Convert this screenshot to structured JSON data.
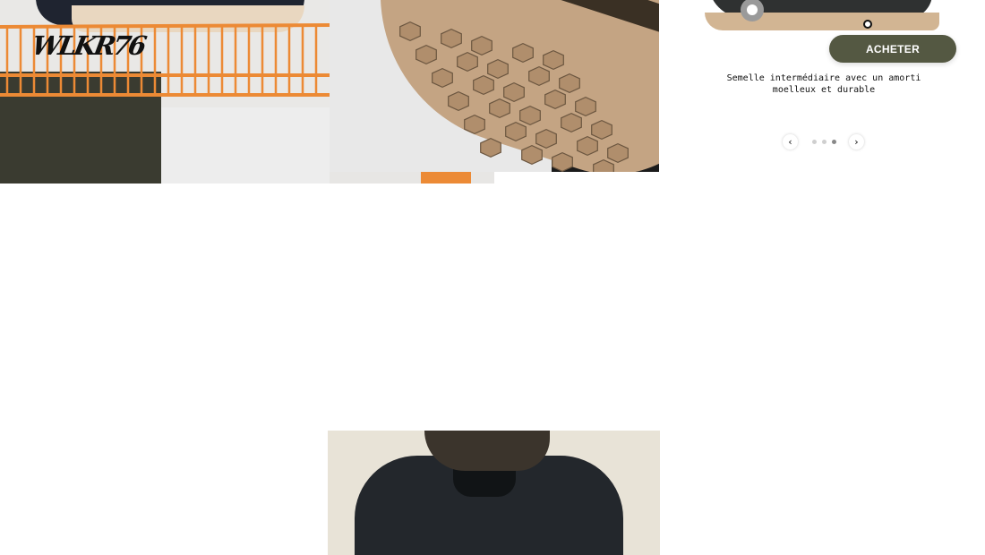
{
  "brand": {
    "logo_text": "WLKR76"
  },
  "product": {
    "buy_label": "ACHETER",
    "feature_caption": "Semelle intermédiaire avec un amorti moelleux et durable"
  },
  "carousel": {
    "prev_icon": "‹",
    "next_icon": "›",
    "slide_count": 3,
    "active_index": 2
  },
  "colors": {
    "buy_button": "#545842",
    "accent_orange": "#ec8a35"
  },
  "icons": [
    "chevron-left-icon",
    "chevron-right-icon"
  ]
}
